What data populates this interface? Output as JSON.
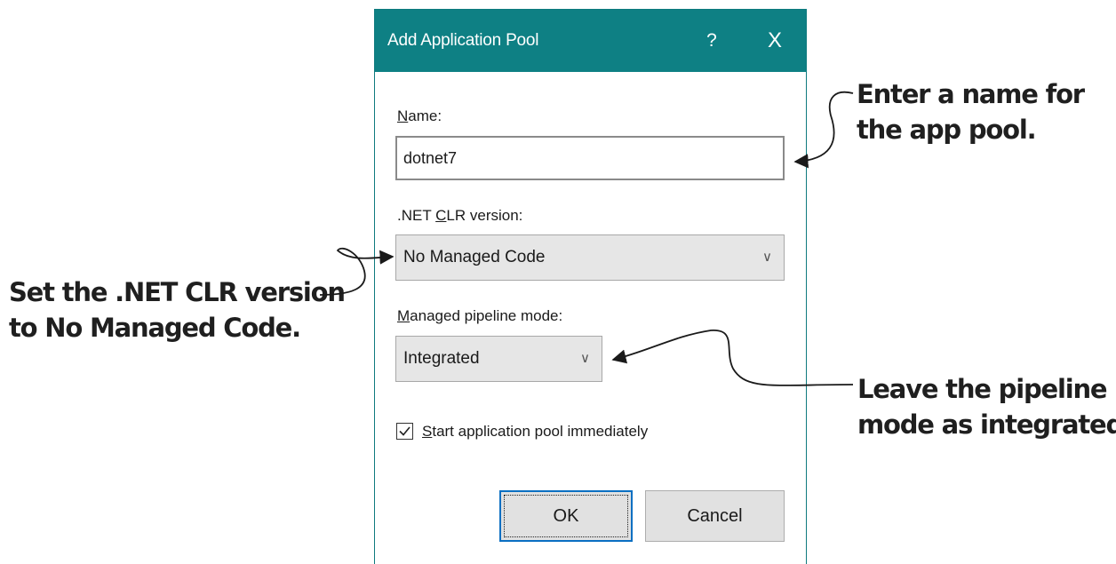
{
  "dialog": {
    "title": "Add Application Pool",
    "help": "?",
    "close": "X",
    "name_label": "Name:",
    "name_value": "dotnet7",
    "clr_label": ".NET CLR version:",
    "clr_value": "No Managed Code",
    "pipeline_label": "Managed pipeline mode:",
    "pipeline_value": "Integrated",
    "start_label": "Start application pool immediately",
    "start_checked": true,
    "ok_label": "OK",
    "cancel_label": "Cancel"
  },
  "callouts": {
    "name_line1": "Enter a name for",
    "name_line2": "the app pool.",
    "clr_line1": "Set the .NET CLR version",
    "clr_line2": "to No Managed Code.",
    "pipeline_line1": "Leave the pipeline",
    "pipeline_line2": "mode as integrated."
  },
  "colors": {
    "titlebar": "#0e8084",
    "ok_border": "#0a6fc2"
  }
}
